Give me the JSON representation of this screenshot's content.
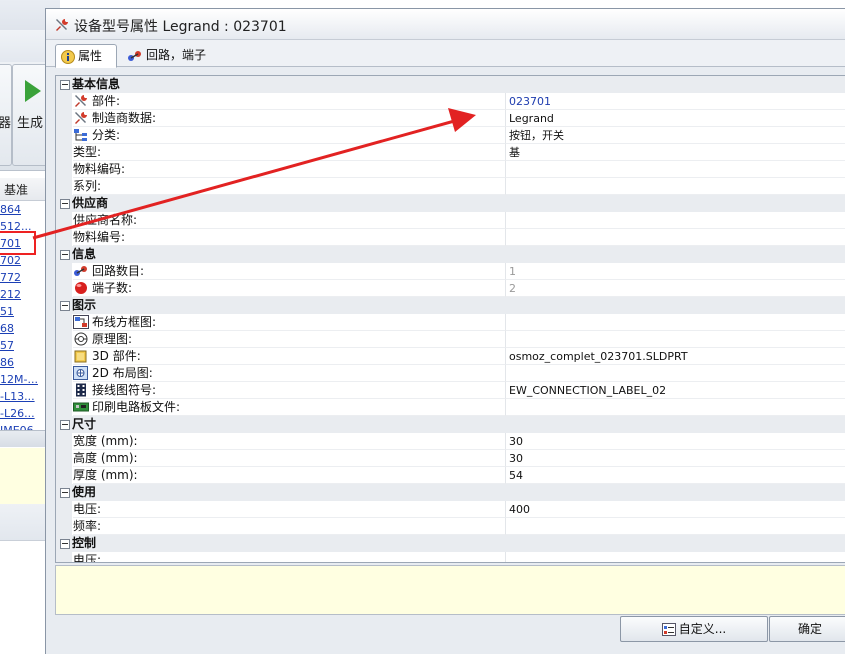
{
  "background_app": {
    "ribbon_partial_label": "器",
    "generate_label": "生成",
    "column_header": "基准",
    "list_items": [
      "864",
      "512...",
      "701",
      "702",
      "772",
      "212",
      "51",
      "68",
      "57",
      "86",
      "12M-...",
      "-L13...",
      "-L26...",
      "IME06..."
    ]
  },
  "dialog": {
    "title": "设备型号属性 Legrand : 023701",
    "tabs": [
      {
        "label": "属性",
        "icon": "info-icon"
      },
      {
        "label": "回路，端子",
        "icon": "circuit-icon"
      }
    ],
    "categories": [
      {
        "label": "基本信息",
        "rows": [
          {
            "name": "部件:",
            "value": "023701",
            "icon": "tools-icon",
            "value_style": "blue"
          },
          {
            "name": "制造商数据:",
            "value": "Legrand",
            "icon": "tools-icon"
          },
          {
            "name": "分类:",
            "value": "按钮，开关",
            "icon": "tree-icon"
          },
          {
            "name": "类型:",
            "value": "基",
            "icon": ""
          },
          {
            "name": "物料编码:",
            "value": "",
            "icon": ""
          },
          {
            "name": "系列:",
            "value": "",
            "icon": ""
          }
        ]
      },
      {
        "label": "供应商",
        "rows": [
          {
            "name": "供应商名称:",
            "value": "",
            "icon": ""
          },
          {
            "name": "物料编号:",
            "value": "",
            "icon": ""
          }
        ]
      },
      {
        "label": "信息",
        "rows": [
          {
            "name": "回路数目:",
            "value": "1",
            "icon": "circuit-icon",
            "value_style": "gray"
          },
          {
            "name": "端子数:",
            "value": "2",
            "icon": "red-ball-icon",
            "value_style": "gray"
          }
        ]
      },
      {
        "label": "图示",
        "rows": [
          {
            "name": "布线方框图:",
            "value": "",
            "icon": "block-diagram-icon"
          },
          {
            "name": "原理图:",
            "value": "",
            "icon": "schematic-icon"
          },
          {
            "name": "3D 部件:",
            "value": "osmoz_complet_023701.SLDPRT",
            "icon": "cube-3d-icon"
          },
          {
            "name": "2D 布局图:",
            "value": "",
            "icon": "layout-2d-icon"
          },
          {
            "name": "接线图符号:",
            "value": "EW_CONNECTION_LABEL_02",
            "icon": "connector-icon"
          },
          {
            "name": "印刷电路板文件:",
            "value": "",
            "icon": "pcb-icon"
          }
        ]
      },
      {
        "label": "尺寸",
        "rows": [
          {
            "name": "宽度 (mm):",
            "value": "30",
            "icon": ""
          },
          {
            "name": "高度 (mm):",
            "value": "30",
            "icon": ""
          },
          {
            "name": "厚度 (mm):",
            "value": "54",
            "icon": ""
          }
        ]
      },
      {
        "label": "使用",
        "rows": [
          {
            "name": "电压:",
            "value": "400",
            "icon": ""
          },
          {
            "name": "频率:",
            "value": "",
            "icon": ""
          }
        ]
      },
      {
        "label": "控制",
        "rows": [
          {
            "name": "电压:",
            "value": "",
            "icon": ""
          }
        ]
      }
    ],
    "buttons": {
      "customize": "自定义...",
      "ok": "确定"
    }
  },
  "colors": {
    "link_blue": "#1e3caf",
    "annotation_red": "#e22222",
    "description_yellow": "#ffffe1"
  }
}
